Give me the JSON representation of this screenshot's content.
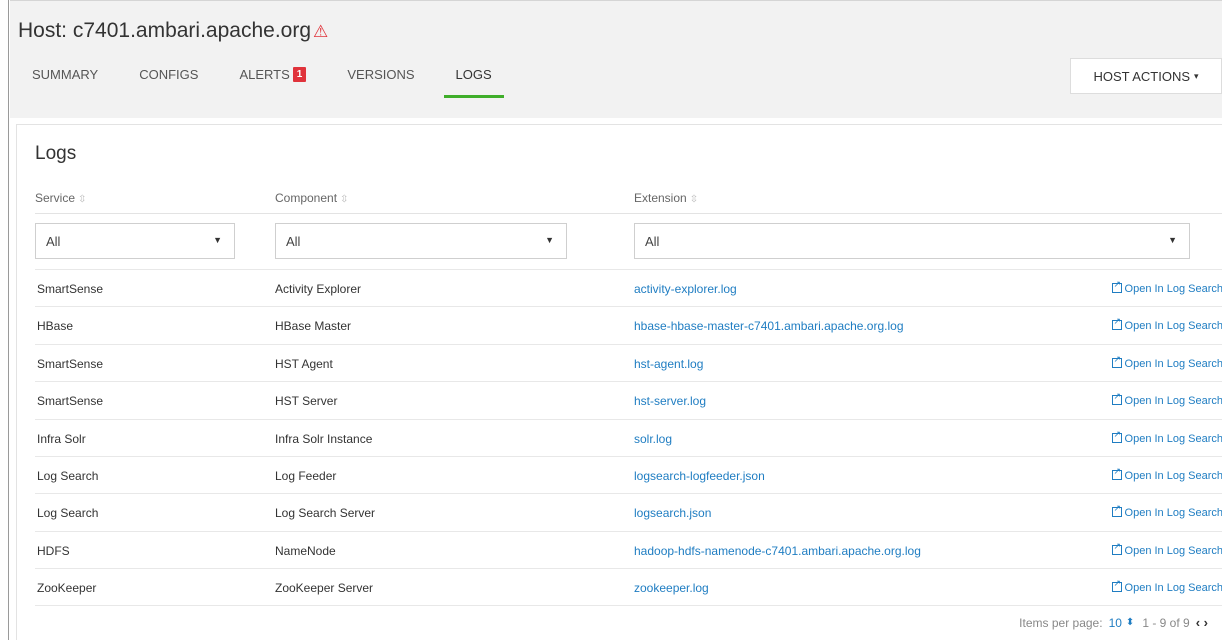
{
  "header": {
    "host_title": "Host: c7401.ambari.apache.org",
    "warning_glyph": "⚠",
    "tabs": [
      {
        "label": "SUMMARY"
      },
      {
        "label": "CONFIGS"
      },
      {
        "label": "ALERTS",
        "badge": "1"
      },
      {
        "label": "VERSIONS"
      },
      {
        "label": "LOGS",
        "active": true
      }
    ],
    "host_actions_label": "HOST ACTIONS",
    "caret": "▾"
  },
  "panel": {
    "title": "Logs",
    "columns": {
      "service": "Service",
      "component": "Component",
      "extension": "Extension"
    },
    "sort_glyph": "⇳",
    "filters": {
      "service": "All",
      "component": "All",
      "extension": "All",
      "dropdown_glyph": "▼"
    },
    "open_label": "Open In Log Search",
    "rows": [
      {
        "service": "SmartSense",
        "component": "Activity Explorer",
        "extension": "activity-explorer.log"
      },
      {
        "service": "HBase",
        "component": "HBase Master",
        "extension": "hbase-hbase-master-c7401.ambari.apache.org.log"
      },
      {
        "service": "SmartSense",
        "component": "HST Agent",
        "extension": "hst-agent.log"
      },
      {
        "service": "SmartSense",
        "component": "HST Server",
        "extension": "hst-server.log"
      },
      {
        "service": "Infra Solr",
        "component": "Infra Solr Instance",
        "extension": "solr.log"
      },
      {
        "service": "Log Search",
        "component": "Log Feeder",
        "extension": "logsearch-logfeeder.json"
      },
      {
        "service": "Log Search",
        "component": "Log Search Server",
        "extension": "logsearch.json"
      },
      {
        "service": "HDFS",
        "component": "NameNode",
        "extension": "hadoop-hdfs-namenode-c7401.ambari.apache.org.log"
      },
      {
        "service": "ZooKeeper",
        "component": "ZooKeeper Server",
        "extension": "zookeeper.log"
      }
    ],
    "pagination": {
      "items_per_page_label": "Items per page:",
      "items_per_page": "10",
      "spinner_glyph": "⬍",
      "range": "1 - 9 of 9",
      "prev": "‹",
      "next": "›"
    }
  },
  "colors": {
    "accent_green": "#3fae2a",
    "link_blue": "#1f7dc2",
    "alert_red": "#e0333b"
  }
}
